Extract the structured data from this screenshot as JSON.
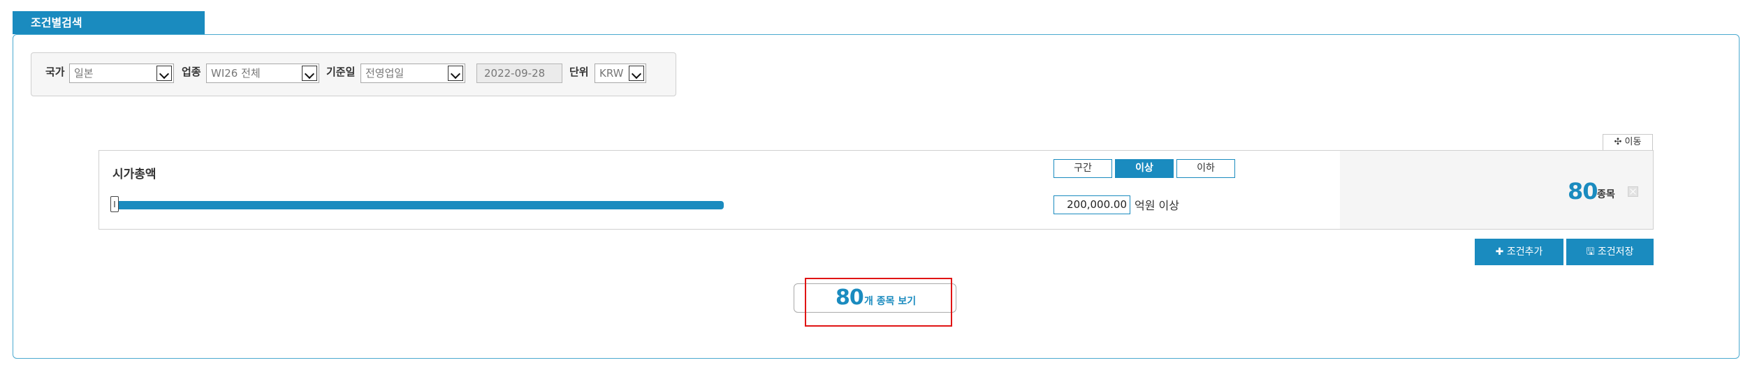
{
  "tab": {
    "title": "조건별검색"
  },
  "filters": {
    "country": {
      "label": "국가",
      "value": "일본"
    },
    "industry": {
      "label": "업종",
      "value": "WI26 전체"
    },
    "base_date": {
      "label": "기준일",
      "value": "전영업일",
      "date": "2022-09-28"
    },
    "currency": {
      "label": "단위",
      "value": "KRW"
    }
  },
  "move_button": {
    "icon": "move-icon",
    "label": "✣ 이동"
  },
  "condition": {
    "title": "시가총액",
    "modes": [
      "구간",
      "이상",
      "이하"
    ],
    "active_mode": "이상",
    "value": "200,000.00",
    "unit_text": "억원 이상",
    "slider_min_fraction": 0,
    "count": "80",
    "count_unit": "종목"
  },
  "actions": {
    "add_label": "✚ 조건추가",
    "save_label": "🖫 조건저장"
  },
  "result": {
    "count": "80",
    "label": "개 종목 보기"
  },
  "colors": {
    "accent": "#1a8bbf",
    "highlight": "#e01414"
  }
}
